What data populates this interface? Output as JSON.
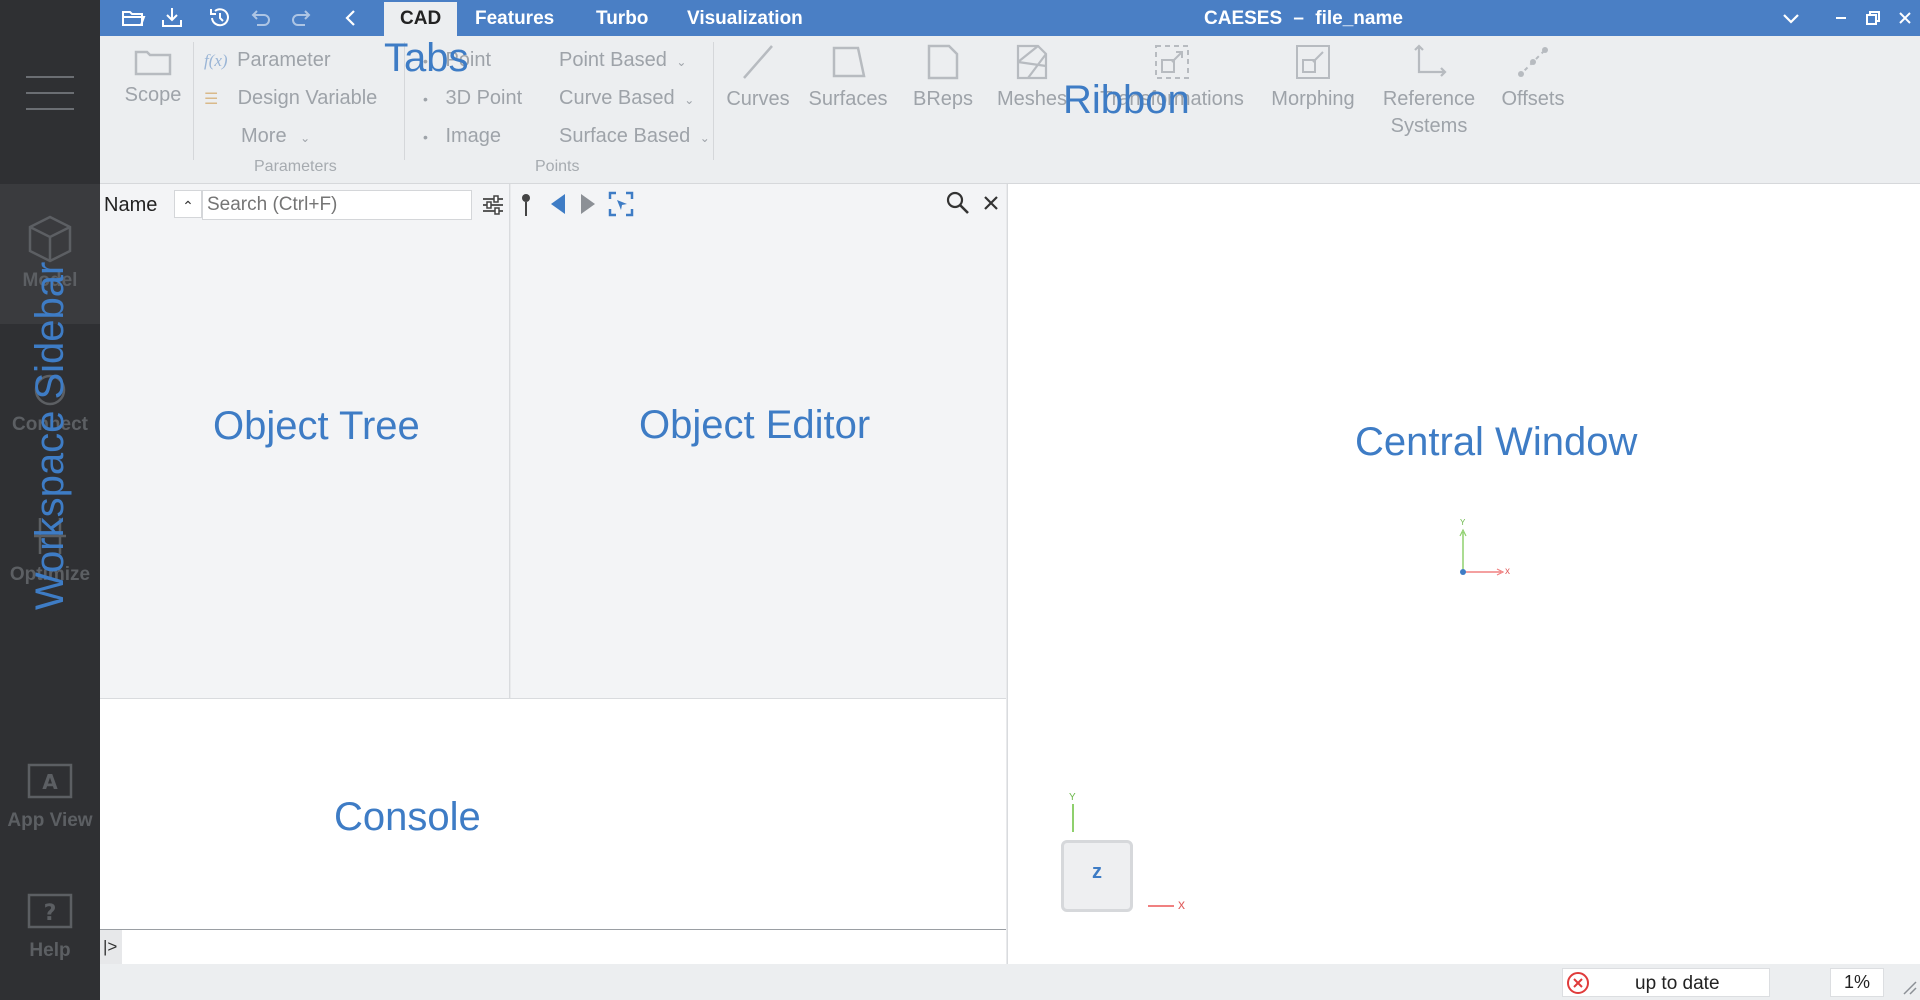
{
  "sidebar": {
    "items": [
      {
        "label": "Model",
        "icon": "cube-icon"
      },
      {
        "label": "Connect",
        "icon": "connect-icon"
      },
      {
        "label": "Optimize",
        "icon": "optimize-icon"
      },
      {
        "label": "App View",
        "icon": "app-view-icon"
      },
      {
        "label": "Help",
        "icon": "help-icon"
      }
    ]
  },
  "titlebar": {
    "title": "CAESES",
    "dash": "–",
    "file": "file_name",
    "tabs": [
      "CAD",
      "Features",
      "Turbo",
      "Visualization"
    ]
  },
  "ribbon": {
    "scope": "Scope",
    "parameter": "Parameter",
    "fx": "f(x)",
    "design_variable": "Design Variable",
    "more": "More",
    "parameters_group": "Parameters",
    "point": "Point",
    "point3d": "3D Point",
    "image": "Image",
    "point_based": "Point Based",
    "curve_based": "Curve Based",
    "surface_based": "Surface Based",
    "points_group": "Points",
    "curves": "Curves",
    "surfaces": "Surfaces",
    "breps": "BReps",
    "meshes": "Meshes",
    "transformations": "Transformations",
    "morphing": "Morphing",
    "reference_systems_1": "Reference",
    "reference_systems_2": "Systems",
    "offsets": "Offsets"
  },
  "tree": {
    "column": "Name",
    "search_placeholder": "Search (Ctrl+F)"
  },
  "console": {
    "prompt": "|>"
  },
  "status": {
    "state": "up to date",
    "percent": "1%"
  },
  "axes": {
    "x": "x",
    "y": "Y",
    "z": "z"
  },
  "annotations": {
    "tabs": "Tabs",
    "ribbon": "Ribbon",
    "sidebar": "Workspace Sidebar",
    "tree": "Object Tree",
    "editor": "Object Editor",
    "central": "Central Window",
    "console": "Console"
  },
  "colors": {
    "accent": "#4a7fc5",
    "annotation": "#3e7cc5",
    "sidebar": "#2f3033"
  }
}
